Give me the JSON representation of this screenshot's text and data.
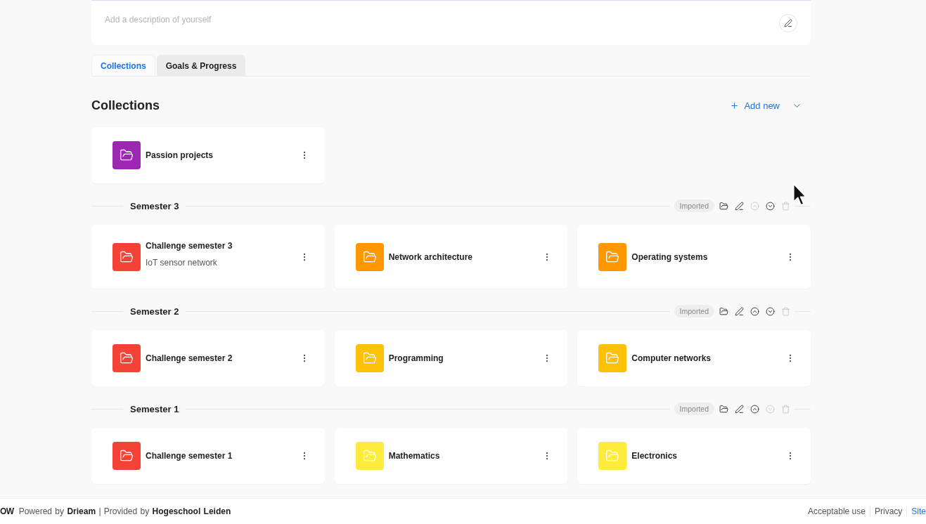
{
  "profile": {
    "description": {
      "placeholder": "Add a description of yourself"
    }
  },
  "tabs": [
    {
      "label": "Collections",
      "selected": true
    },
    {
      "label": "Goals & Progress",
      "selected": false
    }
  ],
  "collections": {
    "title": "Collections",
    "add_button": {
      "label": "Add new"
    },
    "items": [
      {
        "title": "Passion projects",
        "color": "#9c27b0"
      }
    ],
    "groups": [
      {
        "title": "Semester 3",
        "badge": "Imported",
        "actions": [
          {
            "kind": "open",
            "disabled": false
          },
          {
            "kind": "edit",
            "disabled": false
          },
          {
            "kind": "move_up",
            "disabled": true
          },
          {
            "kind": "move_down",
            "disabled": false
          },
          {
            "kind": "delete",
            "disabled": true
          }
        ],
        "items": [
          {
            "title": "Challenge semester 3",
            "subtitle": "IoT sensor network",
            "color": "#f44336"
          },
          {
            "title": "Network architecture",
            "color": "#ff9800"
          },
          {
            "title": "Operating systems",
            "color": "#ff9800"
          }
        ]
      },
      {
        "title": "Semester 2",
        "badge": "Imported",
        "actions": [
          {
            "kind": "open",
            "disabled": false
          },
          {
            "kind": "edit",
            "disabled": false
          },
          {
            "kind": "move_up",
            "disabled": false
          },
          {
            "kind": "move_down",
            "disabled": false
          },
          {
            "kind": "delete",
            "disabled": true
          }
        ],
        "items": [
          {
            "title": "Challenge semester 2",
            "color": "#f44336"
          },
          {
            "title": "Programming",
            "color": "#ffc107"
          },
          {
            "title": "Computer networks",
            "color": "#ffc107"
          }
        ]
      },
      {
        "title": "Semester 1",
        "badge": "Imported",
        "actions": [
          {
            "kind": "open",
            "disabled": false
          },
          {
            "kind": "edit",
            "disabled": false
          },
          {
            "kind": "move_up",
            "disabled": false
          },
          {
            "kind": "move_down",
            "disabled": true
          },
          {
            "kind": "delete",
            "disabled": true
          }
        ],
        "items": [
          {
            "title": "Challenge semester 1",
            "color": "#f44336"
          },
          {
            "title": "Mathematics",
            "color": "#ffeb3b"
          },
          {
            "title": "Electronics",
            "color": "#ffeb3b"
          }
        ]
      }
    ]
  },
  "footer": {
    "brand": "OW",
    "credits": "Powered by **Drieam** | Provided by **Hogeschool Leiden**",
    "links": [
      {
        "label": "Acceptable use",
        "highlighted": false
      },
      {
        "label": "Privacy",
        "highlighted": false
      },
      {
        "label": "Site",
        "highlighted": true
      }
    ]
  }
}
